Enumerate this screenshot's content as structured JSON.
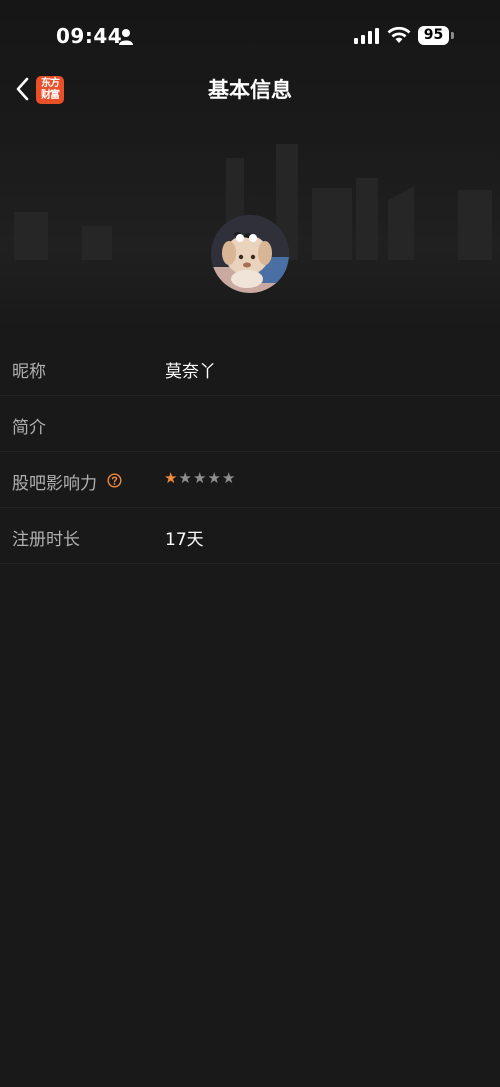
{
  "status_bar": {
    "time": "09:44",
    "battery": "95"
  },
  "nav": {
    "title": "基本信息",
    "logo_text": "东方\n财富",
    "brand_color": "#e8502a"
  },
  "profile": {
    "rows": [
      {
        "label": "昵称",
        "value": "莫奈丫"
      },
      {
        "label": "简介",
        "value": ""
      },
      {
        "label": "股吧影响力",
        "rating": 1,
        "rating_max": 5
      },
      {
        "label": "注册时长",
        "value": "17天"
      }
    ]
  },
  "icons": {
    "back": "chevron-left-icon",
    "help": "question-circle-icon",
    "person": "person-icon",
    "signal": "cellular-signal-icon",
    "wifi": "wifi-icon"
  },
  "colors": {
    "accent": "#f08a3c",
    "background": "#191919"
  }
}
